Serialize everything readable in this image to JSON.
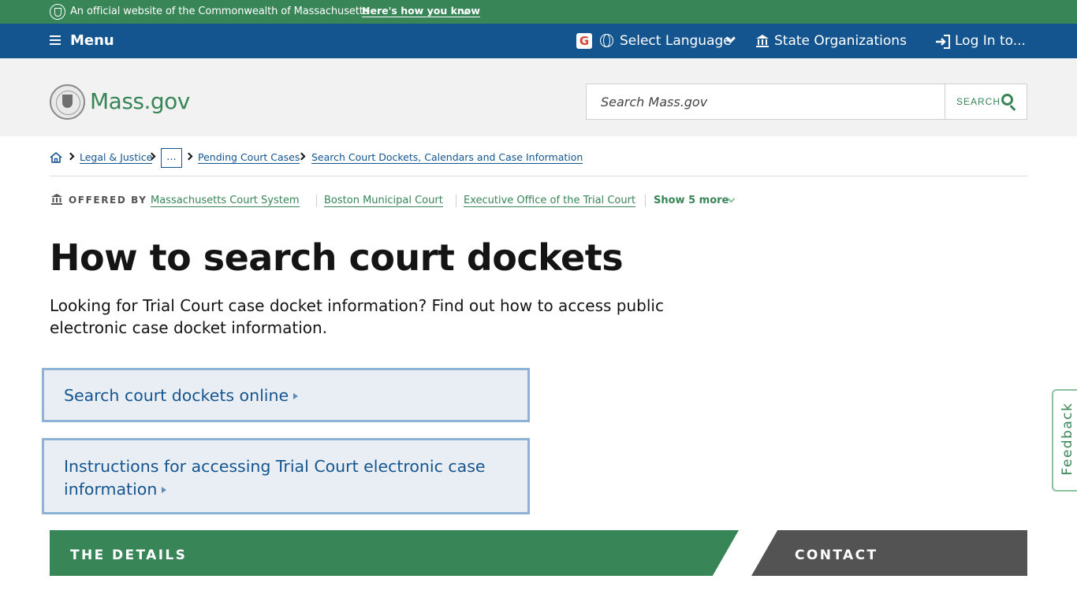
{
  "topbar": {
    "official_text": "An official website of the Commonwealth of Massachusetts",
    "how_you_know": "Here's how you know"
  },
  "navbar": {
    "menu_label": "Menu",
    "google_letter": "G",
    "language_label": "Select Language",
    "organizations_label": "State Organizations",
    "login_label": "Log In to..."
  },
  "header": {
    "logo_text": "Mass.gov",
    "search_placeholder": "Search Mass.gov",
    "search_button_label": "SEARCH"
  },
  "breadcrumb": {
    "items": [
      "Legal & Justice",
      "...",
      "Pending Court Cases",
      "Search Court Dockets, Calendars and Case Information"
    ]
  },
  "offered_by": {
    "label": "OFFERED BY",
    "orgs": [
      "Massachusetts Court System",
      "Boston Municipal Court",
      "Executive Office of the Trial Court"
    ],
    "show_more": "Show 5 more"
  },
  "main": {
    "title": "How to search court dockets",
    "lede": "Looking for Trial Court case docket information? Find out how to access public electronic case docket information.",
    "cards": [
      "Search court dockets online",
      "Instructions for accessing Trial Court electronic case information"
    ]
  },
  "tabs": {
    "details": "THE DETAILS",
    "contact": "CONTACT"
  },
  "feedback": {
    "label": "Feedback"
  },
  "colors": {
    "green": "#388557",
    "blue": "#14558f",
    "dark_gray": "#535353",
    "card_bg": "#e9eef5",
    "card_border": "#8fb1d4"
  }
}
